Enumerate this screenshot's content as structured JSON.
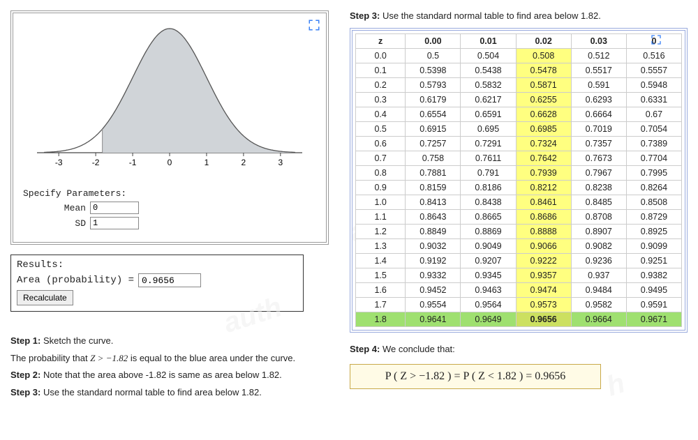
{
  "chart_data": {
    "type": "area",
    "distribution": "standard_normal",
    "mean": 0,
    "sd": 1,
    "x_ticks": [
      -3,
      -2,
      -1,
      0,
      1,
      2,
      3
    ],
    "shade_from": -1.82,
    "shade_to": 3,
    "shaded_area": 0.9656,
    "title": "",
    "xlabel": "",
    "ylabel": ""
  },
  "panel": {
    "spec_header": "Specify Parameters:",
    "mean_label": "Mean",
    "mean_value": "0",
    "sd_label": "SD",
    "sd_value": "1"
  },
  "results": {
    "header": "Results:",
    "area_label": "Area (probability) =",
    "area_value": "0.9656",
    "recalc_label": "Recalculate"
  },
  "steps": {
    "s1_head": "Step 1:",
    "s1_tail": " Sketch the curve.",
    "s1_line2a": "The probability that ",
    "s1_line2b": "Z > −1.82",
    "s1_line2c": " is equal to the blue area under the curve.",
    "s2_head": "Step 2:",
    "s2_tail": " Note that the area above -1.82 is same as area below 1.82.",
    "s3_head": "Step 3:",
    "s3_tail": " Use the standard normal table to find area below 1.82."
  },
  "right": {
    "step3_head": "Step 3:",
    "step3_tail": " Use the standard normal table to find area below 1.82.",
    "step4_head": "Step 4:",
    "step4_tail": " We conclude that:",
    "conclusion": "P ( Z > −1.82 ) = P ( Z < 1.82 ) = 0.9656"
  },
  "z_table": {
    "col_headers": [
      "z",
      "0.00",
      "0.01",
      "0.02",
      "0.03",
      "0.04"
    ],
    "highlight_col_index": 3,
    "highlight_row_index": 18,
    "rows": [
      [
        "0.0",
        "0.5",
        "0.504",
        "0.508",
        "0.512",
        "0.516"
      ],
      [
        "0.1",
        "0.5398",
        "0.5438",
        "0.5478",
        "0.5517",
        "0.5557"
      ],
      [
        "0.2",
        "0.5793",
        "0.5832",
        "0.5871",
        "0.591",
        "0.5948"
      ],
      [
        "0.3",
        "0.6179",
        "0.6217",
        "0.6255",
        "0.6293",
        "0.6331"
      ],
      [
        "0.4",
        "0.6554",
        "0.6591",
        "0.6628",
        "0.6664",
        "0.67"
      ],
      [
        "0.5",
        "0.6915",
        "0.695",
        "0.6985",
        "0.7019",
        "0.7054"
      ],
      [
        "0.6",
        "0.7257",
        "0.7291",
        "0.7324",
        "0.7357",
        "0.7389"
      ],
      [
        "0.7",
        "0.758",
        "0.7611",
        "0.7642",
        "0.7673",
        "0.7704"
      ],
      [
        "0.8",
        "0.7881",
        "0.791",
        "0.7939",
        "0.7967",
        "0.7995"
      ],
      [
        "0.9",
        "0.8159",
        "0.8186",
        "0.8212",
        "0.8238",
        "0.8264"
      ],
      [
        "1.0",
        "0.8413",
        "0.8438",
        "0.8461",
        "0.8485",
        "0.8508"
      ],
      [
        "1.1",
        "0.8643",
        "0.8665",
        "0.8686",
        "0.8708",
        "0.8729"
      ],
      [
        "1.2",
        "0.8849",
        "0.8869",
        "0.8888",
        "0.8907",
        "0.8925"
      ],
      [
        "1.3",
        "0.9032",
        "0.9049",
        "0.9066",
        "0.9082",
        "0.9099"
      ],
      [
        "1.4",
        "0.9192",
        "0.9207",
        "0.9222",
        "0.9236",
        "0.9251"
      ],
      [
        "1.5",
        "0.9332",
        "0.9345",
        "0.9357",
        "0.937",
        "0.9382"
      ],
      [
        "1.6",
        "0.9452",
        "0.9463",
        "0.9474",
        "0.9484",
        "0.9495"
      ],
      [
        "1.7",
        "0.9554",
        "0.9564",
        "0.9573",
        "0.9582",
        "0.9591"
      ],
      [
        "1.8",
        "0.9641",
        "0.9649",
        "0.9656",
        "0.9664",
        "0.9671"
      ]
    ]
  }
}
